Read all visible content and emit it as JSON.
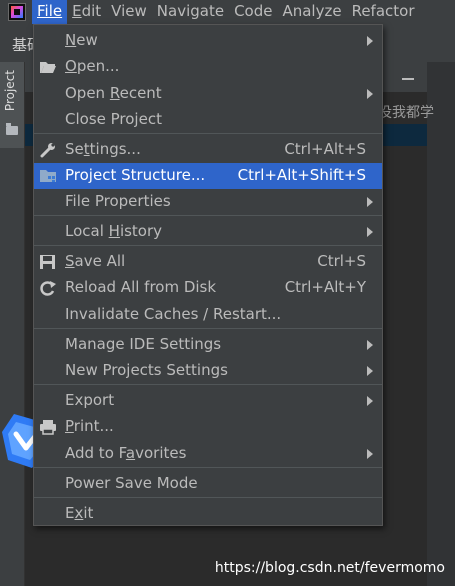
{
  "menubar": {
    "items": [
      {
        "label": "File",
        "active": true
      },
      {
        "label": "Edit"
      },
      {
        "label": "View"
      },
      {
        "label": "Navigate"
      },
      {
        "label": "Code"
      },
      {
        "label": "Analyze"
      },
      {
        "label": "Refactor"
      }
    ]
  },
  "toolbar": {
    "crumb": "基础"
  },
  "left_strip": {
    "project_tab_label": "Project"
  },
  "background": {
    "search_hint": "没我都学"
  },
  "file_menu": {
    "items": [
      {
        "id": "new",
        "pre": "",
        "mn": "N",
        "post": "ew",
        "shortcut": "",
        "submenu": true,
        "icon": ""
      },
      {
        "id": "open",
        "pre": "",
        "mn": "O",
        "post": "pen...",
        "shortcut": "",
        "submenu": false,
        "icon": "folder-open-icon"
      },
      {
        "id": "open-recent",
        "pre": "Open ",
        "mn": "R",
        "post": "ecent",
        "shortcut": "",
        "submenu": true,
        "icon": ""
      },
      {
        "id": "close-project",
        "pre": "Close Project",
        "mn": "",
        "post": "",
        "shortcut": "",
        "submenu": false,
        "icon": ""
      },
      {
        "id": "settings",
        "pre": "Se",
        "mn": "t",
        "post": "tings...",
        "shortcut": "Ctrl+Alt+S",
        "submenu": false,
        "icon": "wrench-icon"
      },
      {
        "id": "project-structure",
        "pre": "Project Structure...",
        "mn": "",
        "post": "",
        "shortcut": "Ctrl+Alt+Shift+S",
        "submenu": false,
        "icon": "project-structure-icon",
        "highlighted": true
      },
      {
        "id": "file-properties",
        "pre": "File Properties",
        "mn": "",
        "post": "",
        "shortcut": "",
        "submenu": true,
        "icon": ""
      },
      {
        "id": "local-history",
        "pre": "Local ",
        "mn": "H",
        "post": "istory",
        "shortcut": "",
        "submenu": true,
        "icon": ""
      },
      {
        "id": "save-all",
        "pre": "",
        "mn": "S",
        "post": "ave All",
        "shortcut": "Ctrl+S",
        "submenu": false,
        "icon": "save-icon"
      },
      {
        "id": "reload-all",
        "pre": "Reload All from Disk",
        "mn": "",
        "post": "",
        "shortcut": "Ctrl+Alt+Y",
        "submenu": false,
        "icon": "reload-icon"
      },
      {
        "id": "invalidate-caches",
        "pre": "Invalidate Caches / Restart...",
        "mn": "",
        "post": "",
        "shortcut": "",
        "submenu": false,
        "icon": ""
      },
      {
        "id": "manage-ide-settings",
        "pre": "Manage IDE Settings",
        "mn": "",
        "post": "",
        "shortcut": "",
        "submenu": true,
        "icon": ""
      },
      {
        "id": "new-projects-settings",
        "pre": "New Projects Settings",
        "mn": "",
        "post": "",
        "shortcut": "",
        "submenu": true,
        "icon": ""
      },
      {
        "id": "export",
        "pre": "Export",
        "mn": "",
        "post": "",
        "shortcut": "",
        "submenu": true,
        "icon": ""
      },
      {
        "id": "print",
        "pre": "",
        "mn": "P",
        "post": "rint...",
        "shortcut": "",
        "submenu": false,
        "icon": "print-icon"
      },
      {
        "id": "add-to-favorites",
        "pre": "Add to F",
        "mn": "a",
        "post": "vorites",
        "shortcut": "",
        "submenu": true,
        "icon": ""
      },
      {
        "id": "power-save-mode",
        "pre": "Power Save Mode",
        "mn": "",
        "post": "",
        "shortcut": "",
        "submenu": false,
        "icon": ""
      },
      {
        "id": "exit",
        "pre": "E",
        "mn": "x",
        "post": "it",
        "shortcut": "",
        "submenu": false,
        "icon": ""
      }
    ]
  },
  "watermark": "https://blog.csdn.net/fevermomo",
  "colors": {
    "highlight": "#2f65ca",
    "menu_bg": "#3c3f41",
    "text": "#bbbbbb"
  }
}
